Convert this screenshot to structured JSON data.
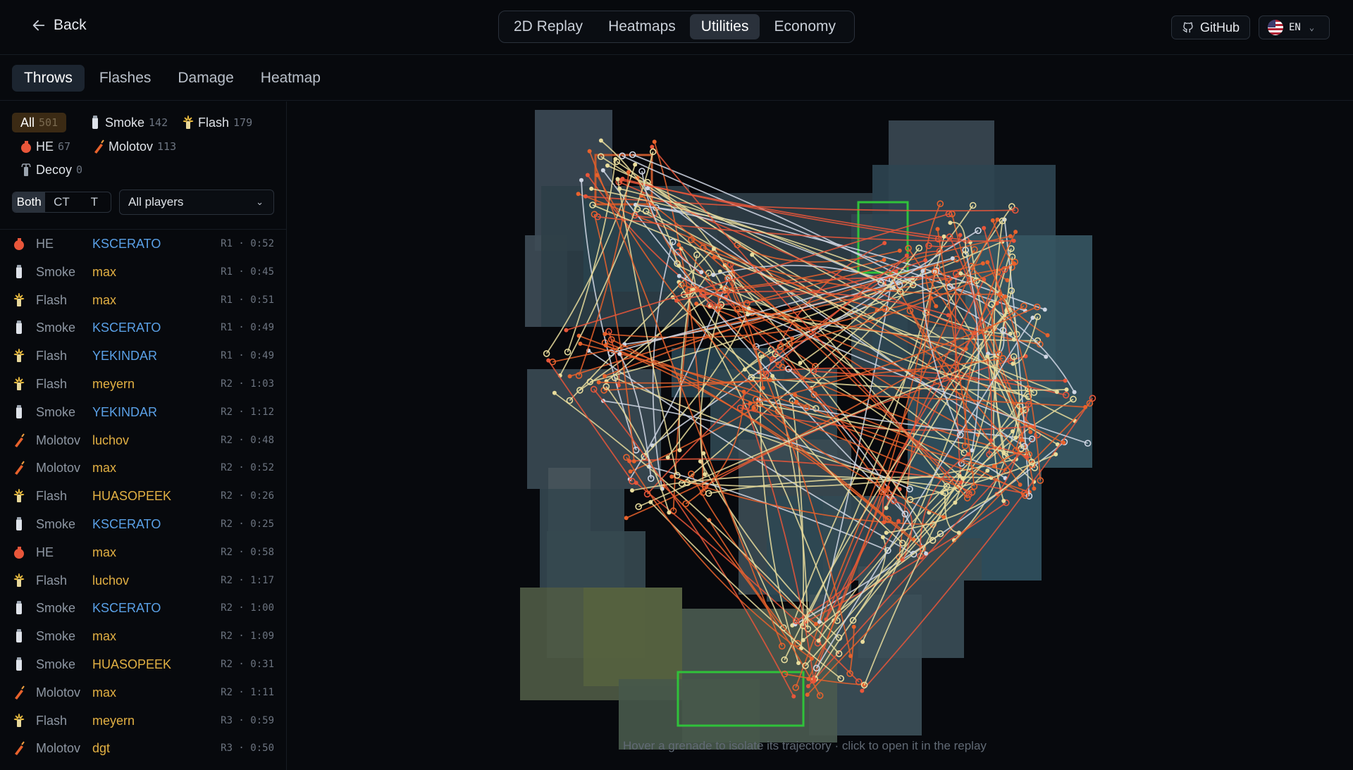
{
  "header": {
    "back_label": "Back",
    "tabs": [
      {
        "label": "2D Replay",
        "active": false
      },
      {
        "label": "Heatmaps",
        "active": false
      },
      {
        "label": "Utilities",
        "active": true
      },
      {
        "label": "Economy",
        "active": false
      }
    ],
    "github_label": "GitHub",
    "language": "EN"
  },
  "subtabs": [
    {
      "label": "Throws",
      "active": true
    },
    {
      "label": "Flashes",
      "active": false
    },
    {
      "label": "Damage",
      "active": false
    },
    {
      "label": "Heatmap",
      "active": false
    }
  ],
  "filters": {
    "types": [
      {
        "label": "All",
        "count": "501",
        "icon": "none",
        "active": true
      },
      {
        "label": "Smoke",
        "count": "142",
        "icon": "smoke-grenade-icon",
        "active": false
      },
      {
        "label": "Flash",
        "count": "179",
        "icon": "flashbang-icon",
        "active": false
      },
      {
        "label": "HE",
        "count": "67",
        "icon": "he-grenade-icon",
        "active": false
      },
      {
        "label": "Molotov",
        "count": "113",
        "icon": "molotov-icon",
        "active": false
      },
      {
        "label": "Decoy",
        "count": "0",
        "icon": "decoy-icon",
        "active": false
      }
    ],
    "sides": [
      {
        "label": "Both",
        "active": true
      },
      {
        "label": "CT",
        "active": false
      },
      {
        "label": "T",
        "active": false
      }
    ],
    "player_select": "All players"
  },
  "throws": [
    {
      "type": "HE",
      "player": "KSCERATO",
      "side": "ct",
      "time": "R1 · 0:52"
    },
    {
      "type": "Smoke",
      "player": "max",
      "side": "t",
      "time": "R1 · 0:45"
    },
    {
      "type": "Flash",
      "player": "max",
      "side": "t",
      "time": "R1 · 0:51"
    },
    {
      "type": "Smoke",
      "player": "KSCERATO",
      "side": "ct",
      "time": "R1 · 0:49"
    },
    {
      "type": "Flash",
      "player": "YEKINDAR",
      "side": "ct",
      "time": "R1 · 0:49"
    },
    {
      "type": "Flash",
      "player": "meyern",
      "side": "t",
      "time": "R2 · 1:03"
    },
    {
      "type": "Smoke",
      "player": "YEKINDAR",
      "side": "ct",
      "time": "R2 · 1:12"
    },
    {
      "type": "Molotov",
      "player": "luchov",
      "side": "t",
      "time": "R2 · 0:48"
    },
    {
      "type": "Molotov",
      "player": "max",
      "side": "t",
      "time": "R2 · 0:52"
    },
    {
      "type": "Flash",
      "player": "HUASOPEEK",
      "side": "t",
      "time": "R2 · 0:26"
    },
    {
      "type": "Smoke",
      "player": "KSCERATO",
      "side": "ct",
      "time": "R2 · 0:25"
    },
    {
      "type": "HE",
      "player": "max",
      "side": "t",
      "time": "R2 · 0:58"
    },
    {
      "type": "Flash",
      "player": "luchov",
      "side": "t",
      "time": "R2 · 1:17"
    },
    {
      "type": "Smoke",
      "player": "KSCERATO",
      "side": "ct",
      "time": "R2 · 1:00"
    },
    {
      "type": "Smoke",
      "player": "max",
      "side": "t",
      "time": "R2 · 1:09"
    },
    {
      "type": "Smoke",
      "player": "HUASOPEEK",
      "side": "t",
      "time": "R2 · 0:31"
    },
    {
      "type": "Molotov",
      "player": "max",
      "side": "t",
      "time": "R2 · 1:11"
    },
    {
      "type": "Flash",
      "player": "meyern",
      "side": "t",
      "time": "R3 · 0:59"
    },
    {
      "type": "Molotov",
      "player": "dgt",
      "side": "t",
      "time": "R3 · 0:50"
    }
  ],
  "map": {
    "hint": "Hover a grenade to isolate its trajectory · click to open it in the replay"
  },
  "colors": {
    "smoke": "#cfd6e4",
    "flash": "#e8dc9c",
    "he": "#e8563a",
    "molotov": "#e8622c",
    "ct": "#5aa0e6",
    "t": "#e2b043",
    "bombsite": "#2fc23a"
  }
}
